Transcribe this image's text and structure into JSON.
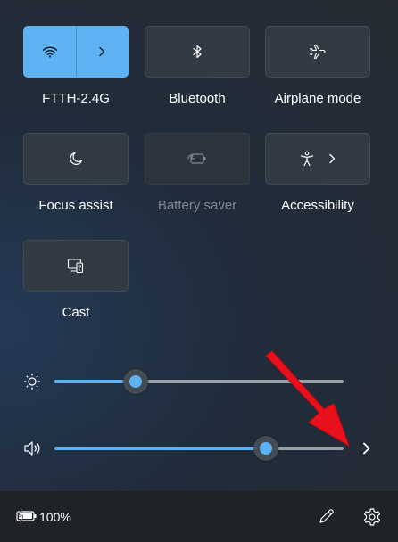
{
  "tiles": {
    "wifi": {
      "label": "FTTH-2.4G",
      "icon": "wifi-icon",
      "state": "on"
    },
    "bluetooth": {
      "label": "Bluetooth",
      "icon": "bluetooth-icon",
      "state": "off"
    },
    "airplane": {
      "label": "Airplane mode",
      "icon": "airplane-icon",
      "state": "off"
    },
    "focus": {
      "label": "Focus assist",
      "icon": "moon-icon",
      "state": "off"
    },
    "battery_saver": {
      "label": "Battery saver",
      "icon": "battery-saver-icon",
      "state": "disabled"
    },
    "accessibility": {
      "label": "Accessibility",
      "icon": "accessibility-icon",
      "state": "off"
    },
    "cast": {
      "label": "Cast",
      "icon": "cast-icon",
      "state": "off"
    }
  },
  "sliders": {
    "brightness": {
      "icon": "brightness-icon",
      "level": 0.28
    },
    "volume": {
      "icon": "volume-icon",
      "level": 0.73
    }
  },
  "footer": {
    "battery_percent": "100%",
    "battery_icon": "battery-charging-icon",
    "edit_icon": "pencil-icon",
    "settings_icon": "gear-icon"
  },
  "annotation": {
    "type": "red-arrow",
    "points_to": "volume-output-chevron"
  },
  "colors": {
    "accent": "#5fb2f2",
    "tile_bg": "#323a44",
    "footer_bg": "#1f2328",
    "disabled_text": "#7f868f",
    "arrow": "#e8101a"
  }
}
